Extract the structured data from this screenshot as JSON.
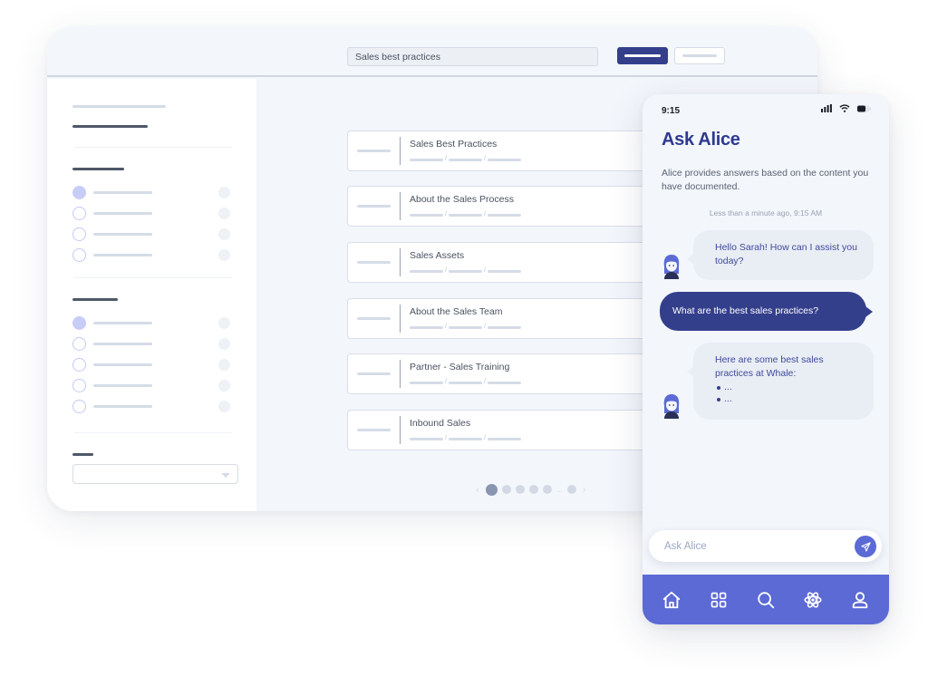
{
  "desktop": {
    "search": {
      "value": "Sales best practices"
    },
    "toolbar": {
      "primary_button": "primary-action",
      "secondary_button": "secondary-action"
    },
    "sidebar": {
      "group1": {
        "options": 4,
        "selected_index": 0
      },
      "group2": {
        "options": 5,
        "selected_index": 0
      },
      "dropdown": {
        "selected": ""
      }
    },
    "results": [
      {
        "title": "Sales Best Practices"
      },
      {
        "title": "About the Sales Process"
      },
      {
        "title": "Sales Assets"
      },
      {
        "title": "About the Sales Team"
      },
      {
        "title": "Partner - Sales Training"
      },
      {
        "title": "Inbound Sales"
      }
    ],
    "pagination": {
      "current_page": 1,
      "visible_pages": 5,
      "ellipsis": "...",
      "prev_icon": "chevron-left-icon",
      "next_icon": "chevron-right-icon"
    }
  },
  "phone": {
    "status": {
      "time": "9:15",
      "icons": [
        "signal-icon",
        "wifi-icon",
        "battery-icon"
      ]
    },
    "title": "Ask Alice",
    "description": "Alice provides answers based on the content you have documented.",
    "timestamp": "Less than a minute ago, 9:15 AM",
    "messages": [
      {
        "sender": "bot",
        "text": "Hello Sarah! How can I assist you today?"
      },
      {
        "sender": "user",
        "text": "What are the best sales practices?"
      },
      {
        "sender": "bot",
        "text": "Here are some best sales practices at Whale:",
        "bullets": [
          "...",
          "..."
        ]
      }
    ],
    "input": {
      "placeholder": "Ask Alice",
      "value": ""
    },
    "tabbar": [
      {
        "icon": "home-icon"
      },
      {
        "icon": "grid-icon"
      },
      {
        "icon": "search-icon"
      },
      {
        "icon": "atom-icon"
      },
      {
        "icon": "user-icon"
      }
    ],
    "colors": {
      "primary": "#343f8c",
      "accent": "#5b6ad5",
      "bubble": "#e9edf4"
    }
  }
}
